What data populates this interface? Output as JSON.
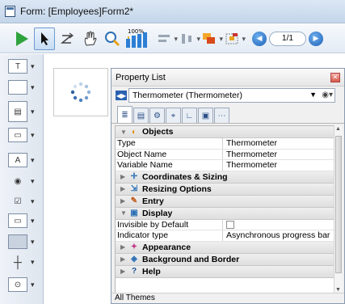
{
  "window": {
    "title": "Form: [Employees]Form2*"
  },
  "toolbar": {
    "zoom_label": "100%",
    "page_counter": "1/1",
    "icons": [
      "play-icon",
      "arrow-pointer-icon",
      "order-icon",
      "hand-icon",
      "zoom-icon",
      "bar-chart-icon",
      "align-icon",
      "distribute-icon",
      "stack-icon",
      "color-icon",
      "prev-page-icon",
      "next-page-icon"
    ]
  },
  "palette": {
    "items": [
      {
        "name": "field-tool",
        "glyph": "T"
      },
      {
        "name": "text-area-tool",
        "glyph": ""
      },
      {
        "name": "list-box-tool",
        "glyph": "▤"
      },
      {
        "name": "combo-tool",
        "glyph": "▭"
      },
      {
        "name": "button-tool",
        "glyph": "A"
      },
      {
        "name": "radio-tool",
        "glyph": "◉"
      },
      {
        "name": "checkbox-tool",
        "glyph": "☑"
      },
      {
        "name": "tab-control-tool",
        "glyph": "▭"
      },
      {
        "name": "rectangle-tool",
        "glyph": "■"
      },
      {
        "name": "splitter-tool",
        "glyph": "┼"
      },
      {
        "name": "plugin-tool",
        "glyph": "⊙"
      }
    ]
  },
  "property_list": {
    "title": "Property List",
    "object_selector": "Thermometer (Thermometer)",
    "status": "All Themes",
    "groups": [
      {
        "label": "Objects",
        "expanded": true,
        "icon": "objects-icon",
        "glyph": "◐",
        "rows": [
          {
            "key": "Type",
            "value": "Thermometer"
          },
          {
            "key": "Object Name",
            "value": "Thermometer"
          },
          {
            "key": "Variable Name",
            "value": "Thermometer"
          }
        ]
      },
      {
        "label": "Coordinates & Sizing",
        "expanded": false,
        "icon": "coordinates-icon",
        "glyph": "✛"
      },
      {
        "label": "Resizing Options",
        "expanded": false,
        "icon": "resizing-icon",
        "glyph": "⇲"
      },
      {
        "label": "Entry",
        "expanded": false,
        "icon": "entry-icon",
        "glyph": "✎"
      },
      {
        "label": "Display",
        "expanded": true,
        "icon": "display-icon",
        "glyph": "▣",
        "rows": [
          {
            "key": "Invisible by Default",
            "value": "",
            "checkbox": true
          },
          {
            "key": "Indicator type",
            "value": "Asynchronous progress bar"
          }
        ]
      },
      {
        "label": "Appearance",
        "expanded": false,
        "icon": "appearance-icon",
        "glyph": "✦"
      },
      {
        "label": "Background and Border",
        "expanded": false,
        "icon": "background-icon",
        "glyph": "◈"
      },
      {
        "label": "Help",
        "expanded": false,
        "icon": "help-icon",
        "glyph": "?"
      }
    ]
  },
  "colors": {
    "accent": "#1c5fb4",
    "play_green": "#2fa33d"
  }
}
